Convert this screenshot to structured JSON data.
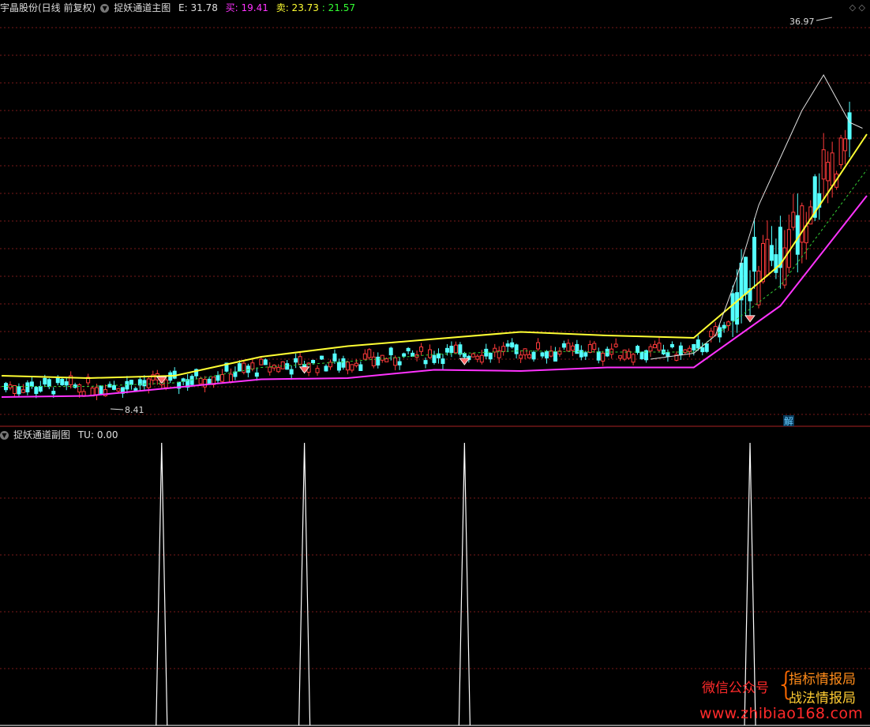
{
  "main_header": {
    "stock_label": "宇晶股份(日线 前复权)",
    "indicator_name": "捉妖通道主图",
    "e_label": "E: 31.78",
    "buy_label": "买: 19.41",
    "sell_label": "卖: 23.73",
    "extra_value": ": 21.57",
    "colors": {
      "e": "#e0e0e0",
      "buy": "#ff33ff",
      "sell": "#ffff33",
      "extra": "#33ff33"
    }
  },
  "sub_header": {
    "indicator_name": "捉妖通道副图",
    "tu_label": "TU: 0.00"
  },
  "annotations": {
    "high_price": "36.97",
    "low_price": "8.41",
    "jie_badge": "解"
  },
  "watermark": {
    "left_text": "微信公众号",
    "brace": "{",
    "right_line1": "指标情报局",
    "right_line2": "战法情报局",
    "url": "www.zhibiao168.com"
  },
  "chart_data": [
    {
      "type": "line",
      "name": "main-candlestick-channel",
      "ylim": [
        6,
        40
      ],
      "grid": true,
      "series": [
        {
          "name": "buy",
          "color": "#ff33ff",
          "x": [
            0,
            20,
            40,
            60,
            80,
            100,
            120,
            140,
            160,
            180,
            200
          ],
          "y": [
            7.8,
            7.9,
            8.6,
            9.3,
            9.4,
            10.1,
            10.0,
            10.3,
            10.3,
            15.5,
            24.8
          ]
        },
        {
          "name": "sell",
          "color": "#ffff33",
          "x": [
            0,
            20,
            40,
            60,
            80,
            100,
            120,
            140,
            160,
            180,
            200
          ],
          "y": [
            9.6,
            9.4,
            9.6,
            11.2,
            12.1,
            12.7,
            13.3,
            13.0,
            12.8,
            19.0,
            30.0
          ]
        },
        {
          "name": "extra",
          "color": "#33cc33",
          "x": [
            0,
            20,
            40,
            60,
            80,
            100,
            120,
            140,
            160,
            180,
            200
          ],
          "y": [
            8.7,
            8.7,
            9.0,
            10.3,
            10.8,
            11.4,
            11.7,
            11.6,
            11.6,
            17.2,
            27.0
          ]
        },
        {
          "name": "E",
          "color": "#e0e0e0",
          "x": [
            150,
            160,
            165,
            170,
            175,
            180,
            185,
            190,
            193,
            196,
            199
          ],
          "y": [
            11.0,
            11.5,
            13.0,
            18.0,
            24.0,
            28.0,
            32.0,
            35.0,
            33.0,
            31.0,
            30.5
          ]
        }
      ]
    },
    {
      "type": "area",
      "name": "sub-tu-spikes",
      "ylim": [
        0,
        1
      ],
      "x": [
        37,
        70,
        107,
        173
      ],
      "values": [
        1,
        1,
        1,
        1
      ]
    }
  ]
}
